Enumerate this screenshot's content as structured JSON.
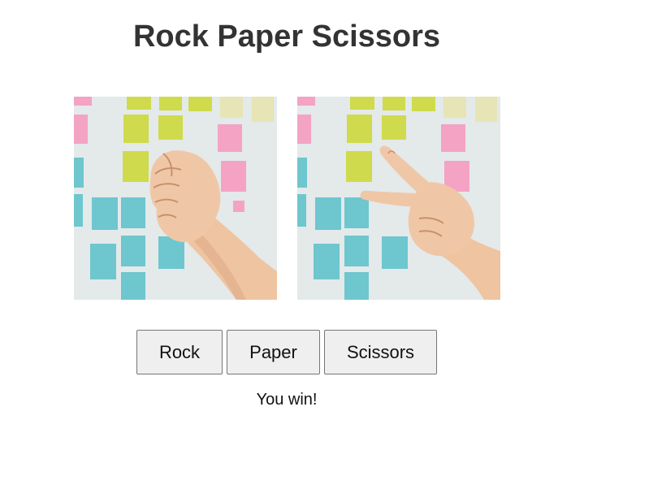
{
  "page": {
    "title": "Rock Paper Scissors"
  },
  "images": {
    "player": {
      "alt": "rock-hand",
      "gesture": "rock"
    },
    "computer": {
      "alt": "scissors-hand",
      "gesture": "scissors"
    }
  },
  "buttons": {
    "rock_label": "Rock",
    "paper_label": "Paper",
    "scissors_label": "Scissors"
  },
  "result": {
    "message": "You win!"
  },
  "colors": {
    "wall": "#e4e9ea",
    "note_yellow": "#cfdb4c",
    "note_pink": "#f4a3c4",
    "note_teal": "#6ec6cf",
    "note_cream": "#e7e4b6",
    "skin": "#f0c7a6",
    "skin_shade": "#dca684"
  }
}
